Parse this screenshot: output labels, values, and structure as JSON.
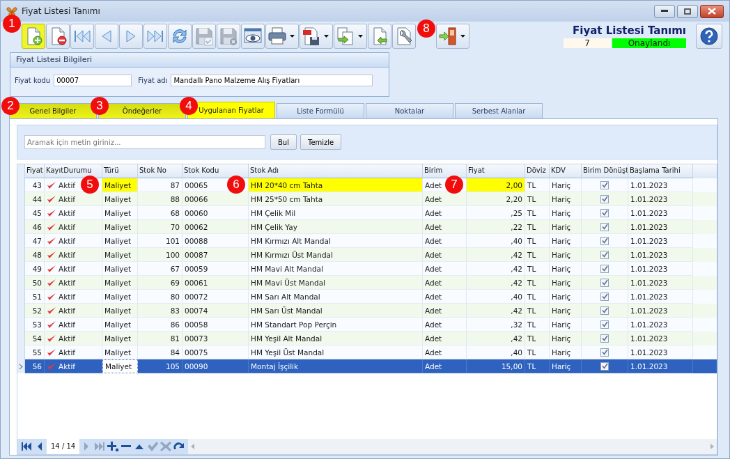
{
  "window": {
    "title": "Fiyat Listesi Tanımı"
  },
  "toolbar": [
    {
      "kind": "new",
      "highlighted": true,
      "disabled": false,
      "dropdown": false,
      "callout": "1"
    },
    {
      "kind": "delete",
      "highlighted": false,
      "disabled": false,
      "dropdown": false
    },
    {
      "kind": "first",
      "highlighted": false,
      "disabled": false,
      "dropdown": false
    },
    {
      "kind": "prev",
      "highlighted": false,
      "disabled": false,
      "dropdown": false
    },
    {
      "kind": "next",
      "highlighted": false,
      "disabled": false,
      "dropdown": false
    },
    {
      "kind": "last",
      "highlighted": false,
      "disabled": false,
      "dropdown": false
    },
    {
      "kind": "refresh",
      "highlighted": false,
      "disabled": false,
      "dropdown": false
    },
    {
      "kind": "save",
      "highlighted": false,
      "disabled": true,
      "dropdown": false
    },
    {
      "kind": "cancel",
      "highlighted": false,
      "disabled": true,
      "dropdown": false
    },
    {
      "kind": "preview",
      "highlighted": false,
      "disabled": false,
      "dropdown": false
    },
    {
      "kind": "print",
      "highlighted": false,
      "disabled": false,
      "dropdown": true
    },
    {
      "kind": "pdf",
      "highlighted": false,
      "disabled": false,
      "dropdown": true
    },
    {
      "kind": "export",
      "highlighted": false,
      "disabled": false,
      "dropdown": true
    },
    {
      "kind": "import",
      "highlighted": false,
      "disabled": false,
      "dropdown": false
    },
    {
      "kind": "tools",
      "highlighted": false,
      "disabled": false,
      "dropdown": false
    },
    {
      "kind": "exit",
      "highlighted": false,
      "disabled": false,
      "dropdown": true,
      "callout": "8"
    }
  ],
  "header": {
    "title": "Fiyat Listesi Tanımı",
    "number": "7",
    "status": "Onaylandı"
  },
  "form": {
    "title": "Fiyat Listesi Bilgileri",
    "fields": [
      {
        "label": "Fiyat kodu",
        "value": "00007"
      },
      {
        "label": "Fiyat adı",
        "value": "Mandallı Pano Malzeme Alış Fiyatları"
      }
    ]
  },
  "tabs": [
    {
      "label": "Genel Bilgiler",
      "selected": false,
      "highlighted": true,
      "callout": "2"
    },
    {
      "label": "Öndeğerler",
      "selected": false,
      "highlighted": true,
      "callout": "3"
    },
    {
      "label": "Uygulanan Fiyatlar",
      "selected": true,
      "highlighted": true,
      "callout": "4"
    },
    {
      "label": "Liste Formülü",
      "selected": false,
      "highlighted": false
    },
    {
      "label": "Noktalar",
      "selected": false,
      "highlighted": false
    },
    {
      "label": "Serbest Alanlar",
      "selected": false,
      "highlighted": false
    }
  ],
  "search": {
    "placeholder": "Aramak için metin giriniz...",
    "buttons": [
      "Bul",
      "Temizle"
    ]
  },
  "table": {
    "columns": [
      "Fiyat",
      "KayıtDurumu",
      "Türü",
      "Stok No",
      "Stok Kodu",
      "Stok Adı",
      "Birim",
      "Fiyat",
      "Döviz",
      "KDV",
      "Birim Dönüşt",
      "Başlama Tarihi"
    ],
    "rows": [
      {
        "selected": false,
        "cells": [
          "43",
          {
            "text": "Aktif",
            "callout": "5"
          },
          {
            "text": "Maliyet",
            "highlighted": true
          },
          "87",
          {
            "text": "00065",
            "callout": "6"
          },
          {
            "text": "HM 20*40 cm Tahta",
            "highlighted": true
          },
          {
            "text": "Adet",
            "callout": "7"
          },
          {
            "text": "2,00",
            "highlighted": true
          },
          "TL",
          "Hariç",
          true,
          "1.01.2023"
        ]
      },
      {
        "selected": false,
        "cells": [
          "44",
          "Aktif",
          "Maliyet",
          "88",
          "00066",
          "HM 25*50 cm Tahta",
          "Adet",
          "2,20",
          "TL",
          "Hariç",
          true,
          "1.01.2023"
        ]
      },
      {
        "selected": false,
        "cells": [
          "45",
          "Aktif",
          "Maliyet",
          "68",
          "00060",
          "HM Çelik Mil",
          "Adet",
          ",25",
          "TL",
          "Hariç",
          true,
          "1.01.2023"
        ]
      },
      {
        "selected": false,
        "cells": [
          "46",
          "Aktif",
          "Maliyet",
          "70",
          "00062",
          "HM Çelik Yay",
          "Adet",
          ",22",
          "TL",
          "Hariç",
          true,
          "1.01.2023"
        ]
      },
      {
        "selected": false,
        "cells": [
          "47",
          "Aktif",
          "Maliyet",
          "101",
          "00088",
          "HM Kırmızı Alt Mandal",
          "Adet",
          ",40",
          "TL",
          "Hariç",
          true,
          "1.01.2023"
        ]
      },
      {
        "selected": false,
        "cells": [
          "48",
          "Aktif",
          "Maliyet",
          "100",
          "00087",
          "HM Kırmızı Üst Mandal",
          "Adet",
          ",42",
          "TL",
          "Hariç",
          true,
          "1.01.2023"
        ]
      },
      {
        "selected": false,
        "cells": [
          "49",
          "Aktif",
          "Maliyet",
          "67",
          "00059",
          "HM Mavi Alt Mandal",
          "Adet",
          ",42",
          "TL",
          "Hariç",
          true,
          "1.01.2023"
        ]
      },
      {
        "selected": false,
        "cells": [
          "50",
          "Aktif",
          "Maliyet",
          "69",
          "00061",
          "HM Mavi Üst Mandal",
          "Adet",
          ",42",
          "TL",
          "Hariç",
          true,
          "1.01.2023"
        ]
      },
      {
        "selected": false,
        "cells": [
          "51",
          "Aktif",
          "Maliyet",
          "80",
          "00072",
          "HM Sarı Alt Mandal",
          "Adet",
          ",40",
          "TL",
          "Hariç",
          true,
          "1.01.2023"
        ]
      },
      {
        "selected": false,
        "cells": [
          "52",
          "Aktif",
          "Maliyet",
          "83",
          "00074",
          "HM Sarı Üst Mandal",
          "Adet",
          ",42",
          "TL",
          "Hariç",
          true,
          "1.01.2023"
        ]
      },
      {
        "selected": false,
        "cells": [
          "53",
          "Aktif",
          "Maliyet",
          "86",
          "00058",
          "HM Standart Pop Perçin",
          "Adet",
          ",32",
          "TL",
          "Hariç",
          true,
          "1.01.2023"
        ]
      },
      {
        "selected": false,
        "cells": [
          "54",
          "Aktif",
          "Maliyet",
          "81",
          "00073",
          "HM Yeşil Alt Mandal",
          "Adet",
          ",42",
          "TL",
          "Hariç",
          true,
          "1.01.2023"
        ]
      },
      {
        "selected": false,
        "cells": [
          "55",
          "Aktif",
          "Maliyet",
          "84",
          "00075",
          "HM Yeşil Üst Mandal",
          "Adet",
          ",40",
          "TL",
          "Hariç",
          true,
          "1.01.2023"
        ]
      },
      {
        "selected": true,
        "cells": [
          "56",
          "Aktif",
          {
            "text": "Maliyet",
            "focused": true
          },
          "105",
          "00090",
          "Montaj İşçilik",
          "Adet",
          "15,00",
          "TL",
          "Hariç",
          true,
          "1.01.2023"
        ]
      }
    ]
  },
  "pager": {
    "position": "14 / 14",
    "buttons": [
      {
        "kind": "first",
        "disabled": false
      },
      {
        "kind": "prev",
        "disabled": false
      },
      {
        "kind": "position"
      },
      {
        "kind": "next",
        "disabled": true
      },
      {
        "kind": "last",
        "disabled": true
      },
      {
        "kind": "add",
        "disabled": false
      },
      {
        "kind": "remove",
        "disabled": false
      },
      {
        "kind": "up",
        "disabled": false
      },
      {
        "kind": "apply",
        "disabled": true
      },
      {
        "kind": "discard",
        "disabled": true
      },
      {
        "kind": "redo",
        "disabled": false
      }
    ]
  }
}
